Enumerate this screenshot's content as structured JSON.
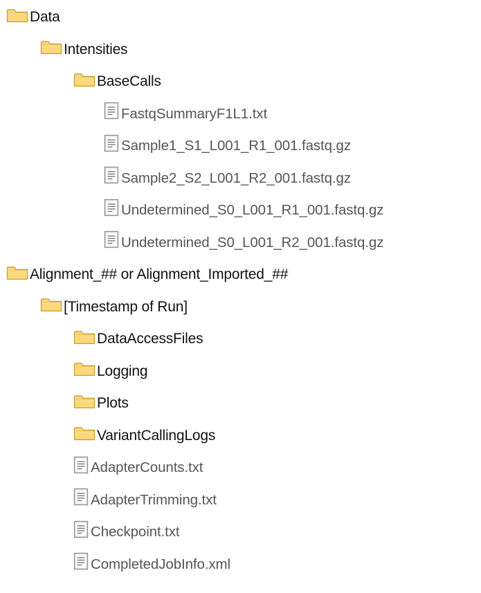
{
  "tree": [
    {
      "type": "folder",
      "level": 0,
      "name": "Data"
    },
    {
      "type": "folder",
      "level": 1,
      "name": "Intensities"
    },
    {
      "type": "folder",
      "level": 2,
      "name": "BaseCalls"
    },
    {
      "type": "file",
      "level": 3,
      "name": "FastqSummaryF1L1.txt"
    },
    {
      "type": "file",
      "level": 3,
      "name": "Sample1_S1_L001_R1_001.fastq.gz"
    },
    {
      "type": "file",
      "level": 3,
      "name": "Sample2_S2_L001_R2_001.fastq.gz"
    },
    {
      "type": "file",
      "level": 3,
      "name": "Undetermined_S0_L001_R1_001.fastq.gz"
    },
    {
      "type": "file",
      "level": 3,
      "name": "Undetermined_S0_L001_R2_001.fastq.gz"
    },
    {
      "type": "folder",
      "level": 0,
      "name": "Alignment_## or Alignment_Imported_##"
    },
    {
      "type": "folder",
      "level": 1,
      "name": "[Timestamp of Run]"
    },
    {
      "type": "folder",
      "level": 2,
      "name": "DataAccessFiles"
    },
    {
      "type": "folder",
      "level": 2,
      "name": "Logging"
    },
    {
      "type": "folder",
      "level": 2,
      "name": "Plots"
    },
    {
      "type": "folder",
      "level": 2,
      "name": "VariantCallingLogs"
    },
    {
      "type": "file",
      "level": 2,
      "name": "AdapterCounts.txt"
    },
    {
      "type": "file",
      "level": 2,
      "name": "AdapterTrimming.txt"
    },
    {
      "type": "file",
      "level": 2,
      "name": "Checkpoint.txt"
    },
    {
      "type": "file",
      "level": 2,
      "name": "CompletedJobInfo.xml"
    }
  ],
  "icons": {
    "folder": "folder-icon",
    "file": "document-icon"
  },
  "colors": {
    "folder_fill": "#FCD87A",
    "folder_border": "#C99A2E",
    "file_fill": "#FFFFFF",
    "file_border": "#8C8C8C",
    "folder_text": "#111111",
    "file_text": "#555555"
  }
}
